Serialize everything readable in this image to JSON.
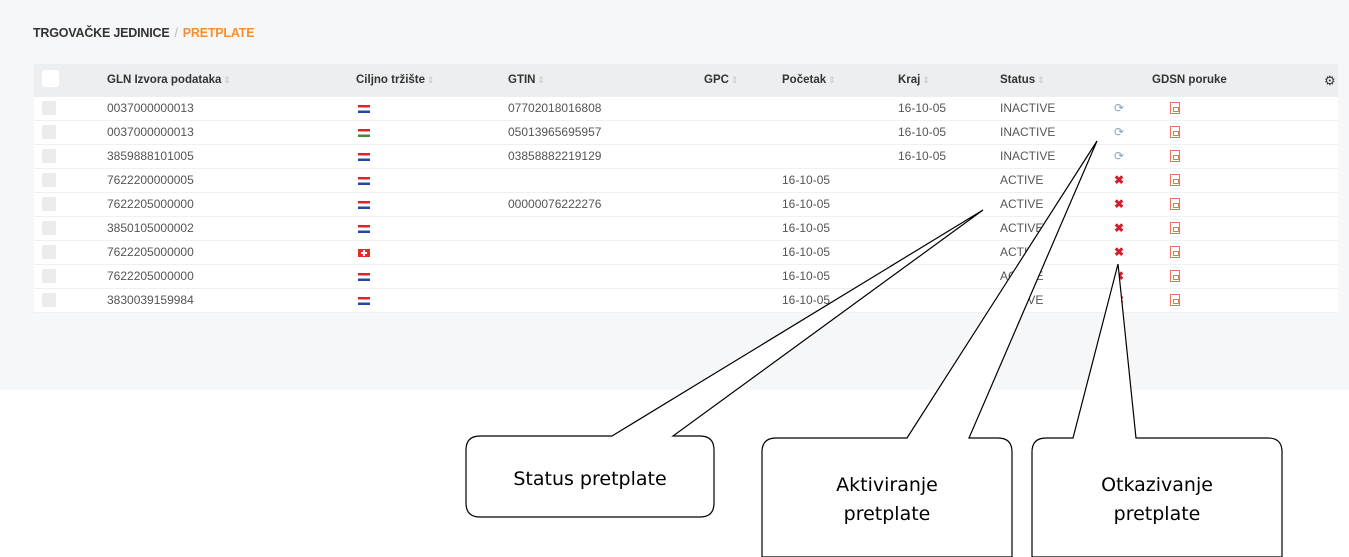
{
  "breadcrumb": {
    "parent": "TRGOVAČKE JEDINICE",
    "separator": "/",
    "current": "PRETPLATE"
  },
  "table": {
    "columns": {
      "gln": "GLN Izvora podataka",
      "market": "Ciljno tržište",
      "gtin": "GTIN",
      "gpc": "GPC",
      "start": "Početak",
      "end": "Kraj",
      "status": "Status",
      "gdsn": "GDSN poruke"
    },
    "sort_glyph": "⇕",
    "settings_icon": "gear-icon",
    "rows": [
      {
        "gln": "0037000000013",
        "flag": "hr",
        "gtin": "07702018016808",
        "gpc": "",
        "start": "",
        "end": "16-10-05",
        "status": "INACTIVE",
        "action": "refresh"
      },
      {
        "gln": "0037000000013",
        "flag": "hu",
        "gtin": "05013965695957",
        "gpc": "",
        "start": "",
        "end": "16-10-05",
        "status": "INACTIVE",
        "action": "refresh"
      },
      {
        "gln": "3859888101005",
        "flag": "hr",
        "gtin": "03858882219129",
        "gpc": "",
        "start": "",
        "end": "16-10-05",
        "status": "INACTIVE",
        "action": "refresh"
      },
      {
        "gln": "7622200000005",
        "flag": "hr",
        "gtin": "",
        "gpc": "",
        "start": "16-10-05",
        "end": "",
        "status": "ACTIVE",
        "action": "cancel"
      },
      {
        "gln": "7622205000000",
        "flag": "hr",
        "gtin": "00000076222276",
        "gpc": "",
        "start": "16-10-05",
        "end": "",
        "status": "ACTIVE",
        "action": "cancel"
      },
      {
        "gln": "3850105000002",
        "flag": "hr",
        "gtin": "",
        "gpc": "",
        "start": "16-10-05",
        "end": "",
        "status": "ACTIVE",
        "action": "cancel"
      },
      {
        "gln": "7622205000000",
        "flag": "ch",
        "gtin": "",
        "gpc": "",
        "start": "16-10-05",
        "end": "",
        "status": "ACTIVE",
        "action": "cancel"
      },
      {
        "gln": "7622205000000",
        "flag": "hr",
        "gtin": "",
        "gpc": "",
        "start": "16-10-05",
        "end": "",
        "status": "ACTIVE",
        "action": "cancel"
      },
      {
        "gln": "3830039159984",
        "flag": "hr",
        "gtin": "",
        "gpc": "",
        "start": "16-10-05",
        "end": "",
        "status": "ACTIVE",
        "action": "cancel"
      }
    ]
  },
  "callouts": {
    "status": [
      "Status pretplate"
    ],
    "activate": [
      "Aktiviranje",
      "pretplate"
    ],
    "cancel": [
      "Otkazivanje",
      "pretplate"
    ]
  },
  "colors": {
    "accent": "#f0913a",
    "inactive_action": "#8aa3b8",
    "cancel_action": "#d0202a",
    "pdf": "#e8755a"
  }
}
